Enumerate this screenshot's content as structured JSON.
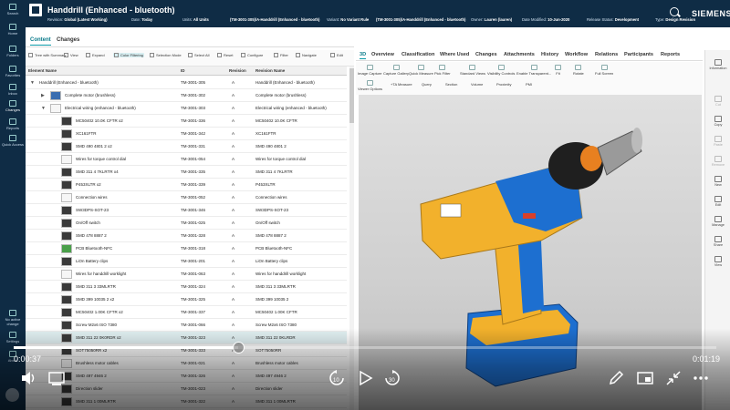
{
  "leftnav": {
    "items": [
      {
        "label": "Search",
        "icon": "search-icon"
      },
      {
        "label": "Home",
        "icon": "home-icon"
      },
      {
        "label": "Folders",
        "icon": "folder-icon"
      },
      {
        "label": "Favorites",
        "icon": "star-icon"
      },
      {
        "label": "Inbox",
        "icon": "inbox-icon"
      },
      {
        "label": "Changes",
        "icon": "changes-icon"
      },
      {
        "label": "Reports",
        "icon": "reports-icon"
      },
      {
        "label": "Quick Access",
        "icon": "quick-access-icon"
      }
    ],
    "bottom": [
      {
        "label": "No active change",
        "icon": "change-icon"
      },
      {
        "label": "Settings",
        "icon": "gear-icon"
      },
      {
        "label": "About",
        "icon": "info-icon"
      }
    ]
  },
  "header": {
    "title": "Handdrill (Enhanced - bluetooth)",
    "revision_rule_label": "Revision:",
    "revision_rule": "Global (Latest Working)",
    "date_label": "Date:",
    "date": "Today",
    "units_label": "Units:",
    "units": "All Units",
    "id_label": "",
    "id_value": "(TM-3001-305)/A-Handdrill (Enhanced - bluetooth)",
    "variant_label": "Variant:",
    "variant": "No Variant Rule",
    "item_label": "",
    "item_value": "(TM-3001-305)/A-Handdrill (Enhanced - bluetooth)",
    "owner_label": "Owner:",
    "owner": "Lauren (lauren)",
    "modified_label": "Date Modified:",
    "modified": "10-Jun-2020",
    "status_label": "Release Status:",
    "status": "Development",
    "type_label": "Type:",
    "type": "Design Revision",
    "brand": "SIEMENS"
  },
  "tabs": [
    "Content",
    "Changes"
  ],
  "toolbar": [
    "Tree with Summary",
    "View",
    "Expand",
    "Color Filtering",
    "Selection Mode",
    "Select All",
    "Reset",
    "Configure",
    "Filter",
    "Navigate",
    "Edit"
  ],
  "table": {
    "headers": [
      "Element Name",
      "ID",
      "Revision",
      "Revision Name"
    ],
    "rows": [
      {
        "name": "Handdrill (Enhanced - bluetooth)",
        "id": "TM-3001-305",
        "rev": "A",
        "revname": "Handdrill (Enhanced - bluetooth)",
        "level": 0,
        "expander": "▼",
        "thumb": "none"
      },
      {
        "name": "Complete motor (brushless)",
        "id": "TM-3001-302",
        "rev": "A",
        "revname": "Complete motor (brushless)",
        "level": 1,
        "expander": "▶",
        "thumb": "blue"
      },
      {
        "name": "Electrical wiring (enhanced - bluetooth)",
        "id": "TM-3001-303",
        "rev": "A",
        "revname": "Electrical wiring (enhanced - bluetooth)",
        "level": 1,
        "expander": "▼",
        "thumb": "white"
      },
      {
        "name": "MC50402 10.0K CFTR x2",
        "id": "TM-3001-336",
        "rev": "A",
        "revname": "MC50402 10.0K CFTR",
        "level": 2,
        "expander": "",
        "thumb": "dark"
      },
      {
        "name": "XC161FTR",
        "id": "TM-3001-342",
        "rev": "A",
        "revname": "XC161FTR",
        "level": 2,
        "expander": "",
        "thumb": "dark"
      },
      {
        "name": "SMD 490 4801 2 x2",
        "id": "TM-3001-331",
        "rev": "A",
        "revname": "SMD 490 4801 2",
        "level": 2,
        "expander": "",
        "thumb": "dark"
      },
      {
        "name": "Wires for torque control dial",
        "id": "TM-3001-054",
        "rev": "A",
        "revname": "Wires for torque control dial",
        "level": 2,
        "expander": "",
        "thumb": "white"
      },
      {
        "name": "SMD 311 4 7KLRTR x4",
        "id": "TM-3001-335",
        "rev": "A",
        "revname": "SMD 311 4 7KLRTR",
        "level": 2,
        "expander": "",
        "thumb": "dark"
      },
      {
        "name": "P453XLTR x2",
        "id": "TM-3001-339",
        "rev": "A",
        "revname": "P453XLTR",
        "level": 2,
        "expander": "",
        "thumb": "dark"
      },
      {
        "name": "Connection wires",
        "id": "TM-3001-052",
        "rev": "A",
        "revname": "Connection wires",
        "level": 2,
        "expander": "",
        "thumb": "white"
      },
      {
        "name": "SW3DPS-SOT-23",
        "id": "TM-3001-346",
        "rev": "A",
        "revname": "SW3DPS-SOT-23",
        "level": 2,
        "expander": "",
        "thumb": "dark"
      },
      {
        "name": "On/Off switch",
        "id": "TM-3001-025",
        "rev": "A",
        "revname": "On/Off switch",
        "level": 2,
        "expander": "",
        "thumb": "dark"
      },
      {
        "name": "SMD 478 8887 2",
        "id": "TM-3001-328",
        "rev": "A",
        "revname": "SMD 478 8887 2",
        "level": 2,
        "expander": "",
        "thumb": "dark"
      },
      {
        "name": "PCB Bluetooth-NFC",
        "id": "TM-3001-318",
        "rev": "A",
        "revname": "PCB Bluetooth-NFC",
        "level": 2,
        "expander": "",
        "thumb": "green"
      },
      {
        "name": "LiOn Battery clips",
        "id": "TM-3001-201",
        "rev": "A",
        "revname": "LiOn Battery clips",
        "level": 2,
        "expander": "",
        "thumb": "dark"
      },
      {
        "name": "Wires for handdrill worklight",
        "id": "TM-3001-063",
        "rev": "A",
        "revname": "Wires for handdrill worklight",
        "level": 2,
        "expander": "",
        "thumb": "white"
      },
      {
        "name": "SMD 311 3 33MLRTR",
        "id": "TM-3001-324",
        "rev": "A",
        "revname": "SMD 311 3 33MLRTR",
        "level": 2,
        "expander": "",
        "thumb": "dark"
      },
      {
        "name": "SMD 399 10035 2 x2",
        "id": "TM-3001-325",
        "rev": "A",
        "revname": "SMD 399 10035 2",
        "level": 2,
        "expander": "",
        "thumb": "dark"
      },
      {
        "name": "MC50402 1.00K CFTR x2",
        "id": "TM-3001-337",
        "rev": "A",
        "revname": "MC50402 1.00K CFTR",
        "level": 2,
        "expander": "",
        "thumb": "dark"
      },
      {
        "name": "Screw M2x6 ISO 7380",
        "id": "TM-3001-066",
        "rev": "A",
        "revname": "Screw M2x6 ISO 7380",
        "level": 2,
        "expander": "",
        "thumb": "dark"
      },
      {
        "name": "SMD 311 22 0K0RDR x2",
        "id": "TM-3001-323",
        "rev": "A",
        "revname": "SMD 311 22 0KLRDR",
        "level": 2,
        "expander": "",
        "thumb": "dark"
      },
      {
        "name": "SOT75050RR x2",
        "id": "TM-3001-333",
        "rev": "A",
        "revname": "SOT75050RR",
        "level": 2,
        "expander": "",
        "thumb": "dark"
      },
      {
        "name": "Brushless motor cables",
        "id": "TM-3001-021",
        "rev": "A",
        "revname": "Brushless motor cables",
        "level": 2,
        "expander": "",
        "thumb": "white"
      },
      {
        "name": "SMD 497 4946 2",
        "id": "TM-3001-326",
        "rev": "A",
        "revname": "SMD 497 4946 2",
        "level": 2,
        "expander": "",
        "thumb": "dark"
      },
      {
        "name": "Direction slider",
        "id": "TM-3001-023",
        "rev": "A",
        "revname": "Direction slider",
        "level": 2,
        "expander": "",
        "thumb": "dark"
      },
      {
        "name": "SMD 311 1 00MLRTR",
        "id": "TM-3001-322",
        "rev": "A",
        "revname": "SMD 311 1 00MLRTR",
        "level": 2,
        "expander": "",
        "thumb": "dark"
      }
    ]
  },
  "tabs3d": [
    "3D",
    "Overview",
    "Classification",
    "Where Used",
    "Changes",
    "Attachments",
    "History",
    "Workflow",
    "Relations",
    "Participants",
    "Reports"
  ],
  "tool3d": {
    "row1": [
      "Image Capture",
      "Capture Gallery",
      "Quick Measure",
      "Pick Filter",
      "Standard Views",
      "Visibility Controls",
      "Enable Transparent...",
      "Fit",
      "Rotate",
      "Full Screen"
    ],
    "row2": [
      "Viewer Options",
      "+TA Measure",
      "Query",
      "Section",
      "Volume",
      "Proximity",
      "PMI"
    ]
  },
  "rightpanel": [
    "Information",
    "Cut",
    "Copy",
    "Paste",
    "Remove",
    "New",
    "Edit",
    "Manage",
    "Share",
    "View"
  ],
  "video": {
    "current_time": "0:00:37",
    "total_time": "0:01:19",
    "progress": 0.32
  },
  "colors": {
    "nav_bg": "#0f2c45",
    "accent": "#0a9aa8",
    "drill_yellow": "#f2b12c",
    "drill_blue": "#1d6fd0"
  }
}
